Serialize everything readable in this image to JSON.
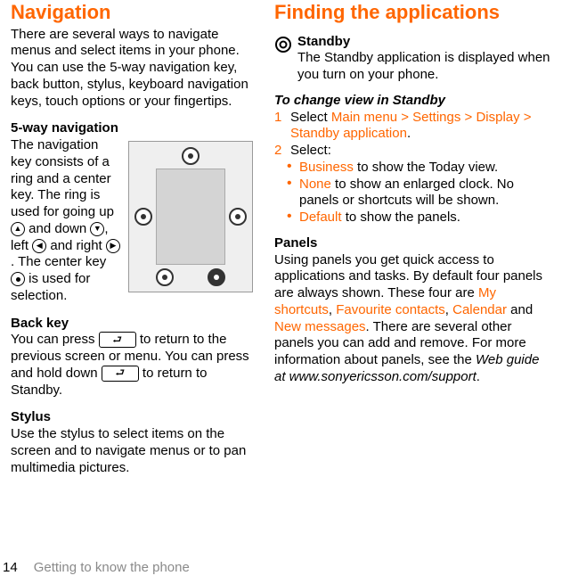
{
  "footer": {
    "page_number": "14",
    "section_label": "Getting to know the phone"
  },
  "left": {
    "title": "Navigation",
    "intro": "There are several ways to navigate menus and select items in your phone. You can use the 5-way navigation key, back button, stylus, keyboard navigation keys, touch options or your fingertips.",
    "nav5": {
      "heading": "5-way navigation",
      "t1": "The navigation key consists of a ring and a center key. The ring is used for going up ",
      "t_and": " and down ",
      "t_left": ", left ",
      "t_right": " and right ",
      "t_center": ". The center key ",
      "t_end": " is used for selection."
    },
    "back": {
      "heading": "Back key",
      "t1": "You can press ",
      "t2": " to return to the previous screen or menu. You can press and hold down ",
      "t3": " to return to Standby."
    },
    "stylus": {
      "heading": "Stylus",
      "body": "Use the stylus to select items on the screen and to navigate menus or to pan multimedia pictures."
    }
  },
  "right": {
    "title": "Finding the applications",
    "standby": {
      "heading": "Standby",
      "body": "The Standby application is displayed when you turn on your phone."
    },
    "change": {
      "heading": "To change view in Standby",
      "step1_pre": "Select ",
      "step1_path": "Main menu > Settings > Display > Standby application",
      "step1_post": ".",
      "step2": "Select:",
      "b1_hl": "Business",
      "b1_rest": " to show the Today view.",
      "b2_hl": "None",
      "b2_rest": " to show an enlarged clock. No panels or shortcuts will be shown.",
      "b3_hl": "Default",
      "b3_rest": " to show the panels."
    },
    "panels": {
      "heading": "Panels",
      "t1": "Using panels you get quick access to applications and tasks. By default four panels are always shown. These four are ",
      "hl1": "My shortcuts",
      "sep1": ", ",
      "hl2": "Favourite contacts",
      "sep2": ", ",
      "hl3": "Calendar",
      "and": " and ",
      "hl4": "New messages",
      "t2": ". There are several other panels you can add and remove. For more information about panels, see the ",
      "guide": "Web guide at www.sonyericsson.com/support",
      "t3": "."
    }
  }
}
